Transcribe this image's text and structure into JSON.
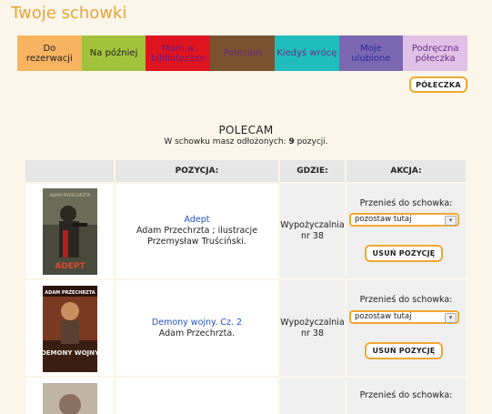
{
  "page": {
    "title": "Twoje schowki"
  },
  "tabs": [
    {
      "label": "Do rezerwacji",
      "bg": "#f7b360",
      "fg": "#222222"
    },
    {
      "label": "Na później",
      "bg": "#a3c23b",
      "fg": "#222222"
    },
    {
      "label": "Mam w biblioteczce",
      "bg": "#e0141e",
      "fg": "#6a1a8a"
    },
    {
      "label": "Polecam",
      "bg": "#7a5230",
      "fg": "#6a2a8a"
    },
    {
      "label": "Kiedyś wrócę",
      "bg": "#21bdbd",
      "fg": "#6a2a8a"
    },
    {
      "label": "Moje ulubione",
      "bg": "#7b68b0",
      "fg": "#2a2a9a"
    },
    {
      "label": "Podręczna półeczka",
      "bg": "#e0c0e6",
      "fg": "#6a2a8a"
    }
  ],
  "shelf_button": "PÓŁECZKA",
  "section": {
    "title": "POLECAM",
    "summary_prefix": "W schowku masz odłożonych: ",
    "count": "9",
    "summary_suffix": " pozycji."
  },
  "table": {
    "headers": {
      "cover": "",
      "position": "POZYCJA:",
      "where": "GDZIE:",
      "action": "AKCJA:"
    },
    "rows": [
      {
        "title": "Adept",
        "desc": "Adam Przechrzta ; ilustracje Przemysław Truściński.",
        "where": "Wypożyczalnia nr 38",
        "move_label": "Przenieś do schowka:",
        "select_value": "pozostaw tutaj",
        "remove_label": "USUŃ POZYCJĘ",
        "cover_author": "ADAM PRZECHRZTA",
        "cover_title": "ADEPT"
      },
      {
        "title": "Demony wojny. Cz. 2",
        "desc": "Adam Przechrzta.",
        "where": "Wypożyczalnia nr 38",
        "move_label": "Przenieś do schowka:",
        "select_value": "pozostaw tutaj",
        "remove_label": "USUŃ POZYCJĘ",
        "cover_author": "ADAM PRZECHRZTA",
        "cover_title": "DEMONY WOJNY"
      },
      {
        "move_label": "Przenieś do schowka:"
      }
    ]
  }
}
